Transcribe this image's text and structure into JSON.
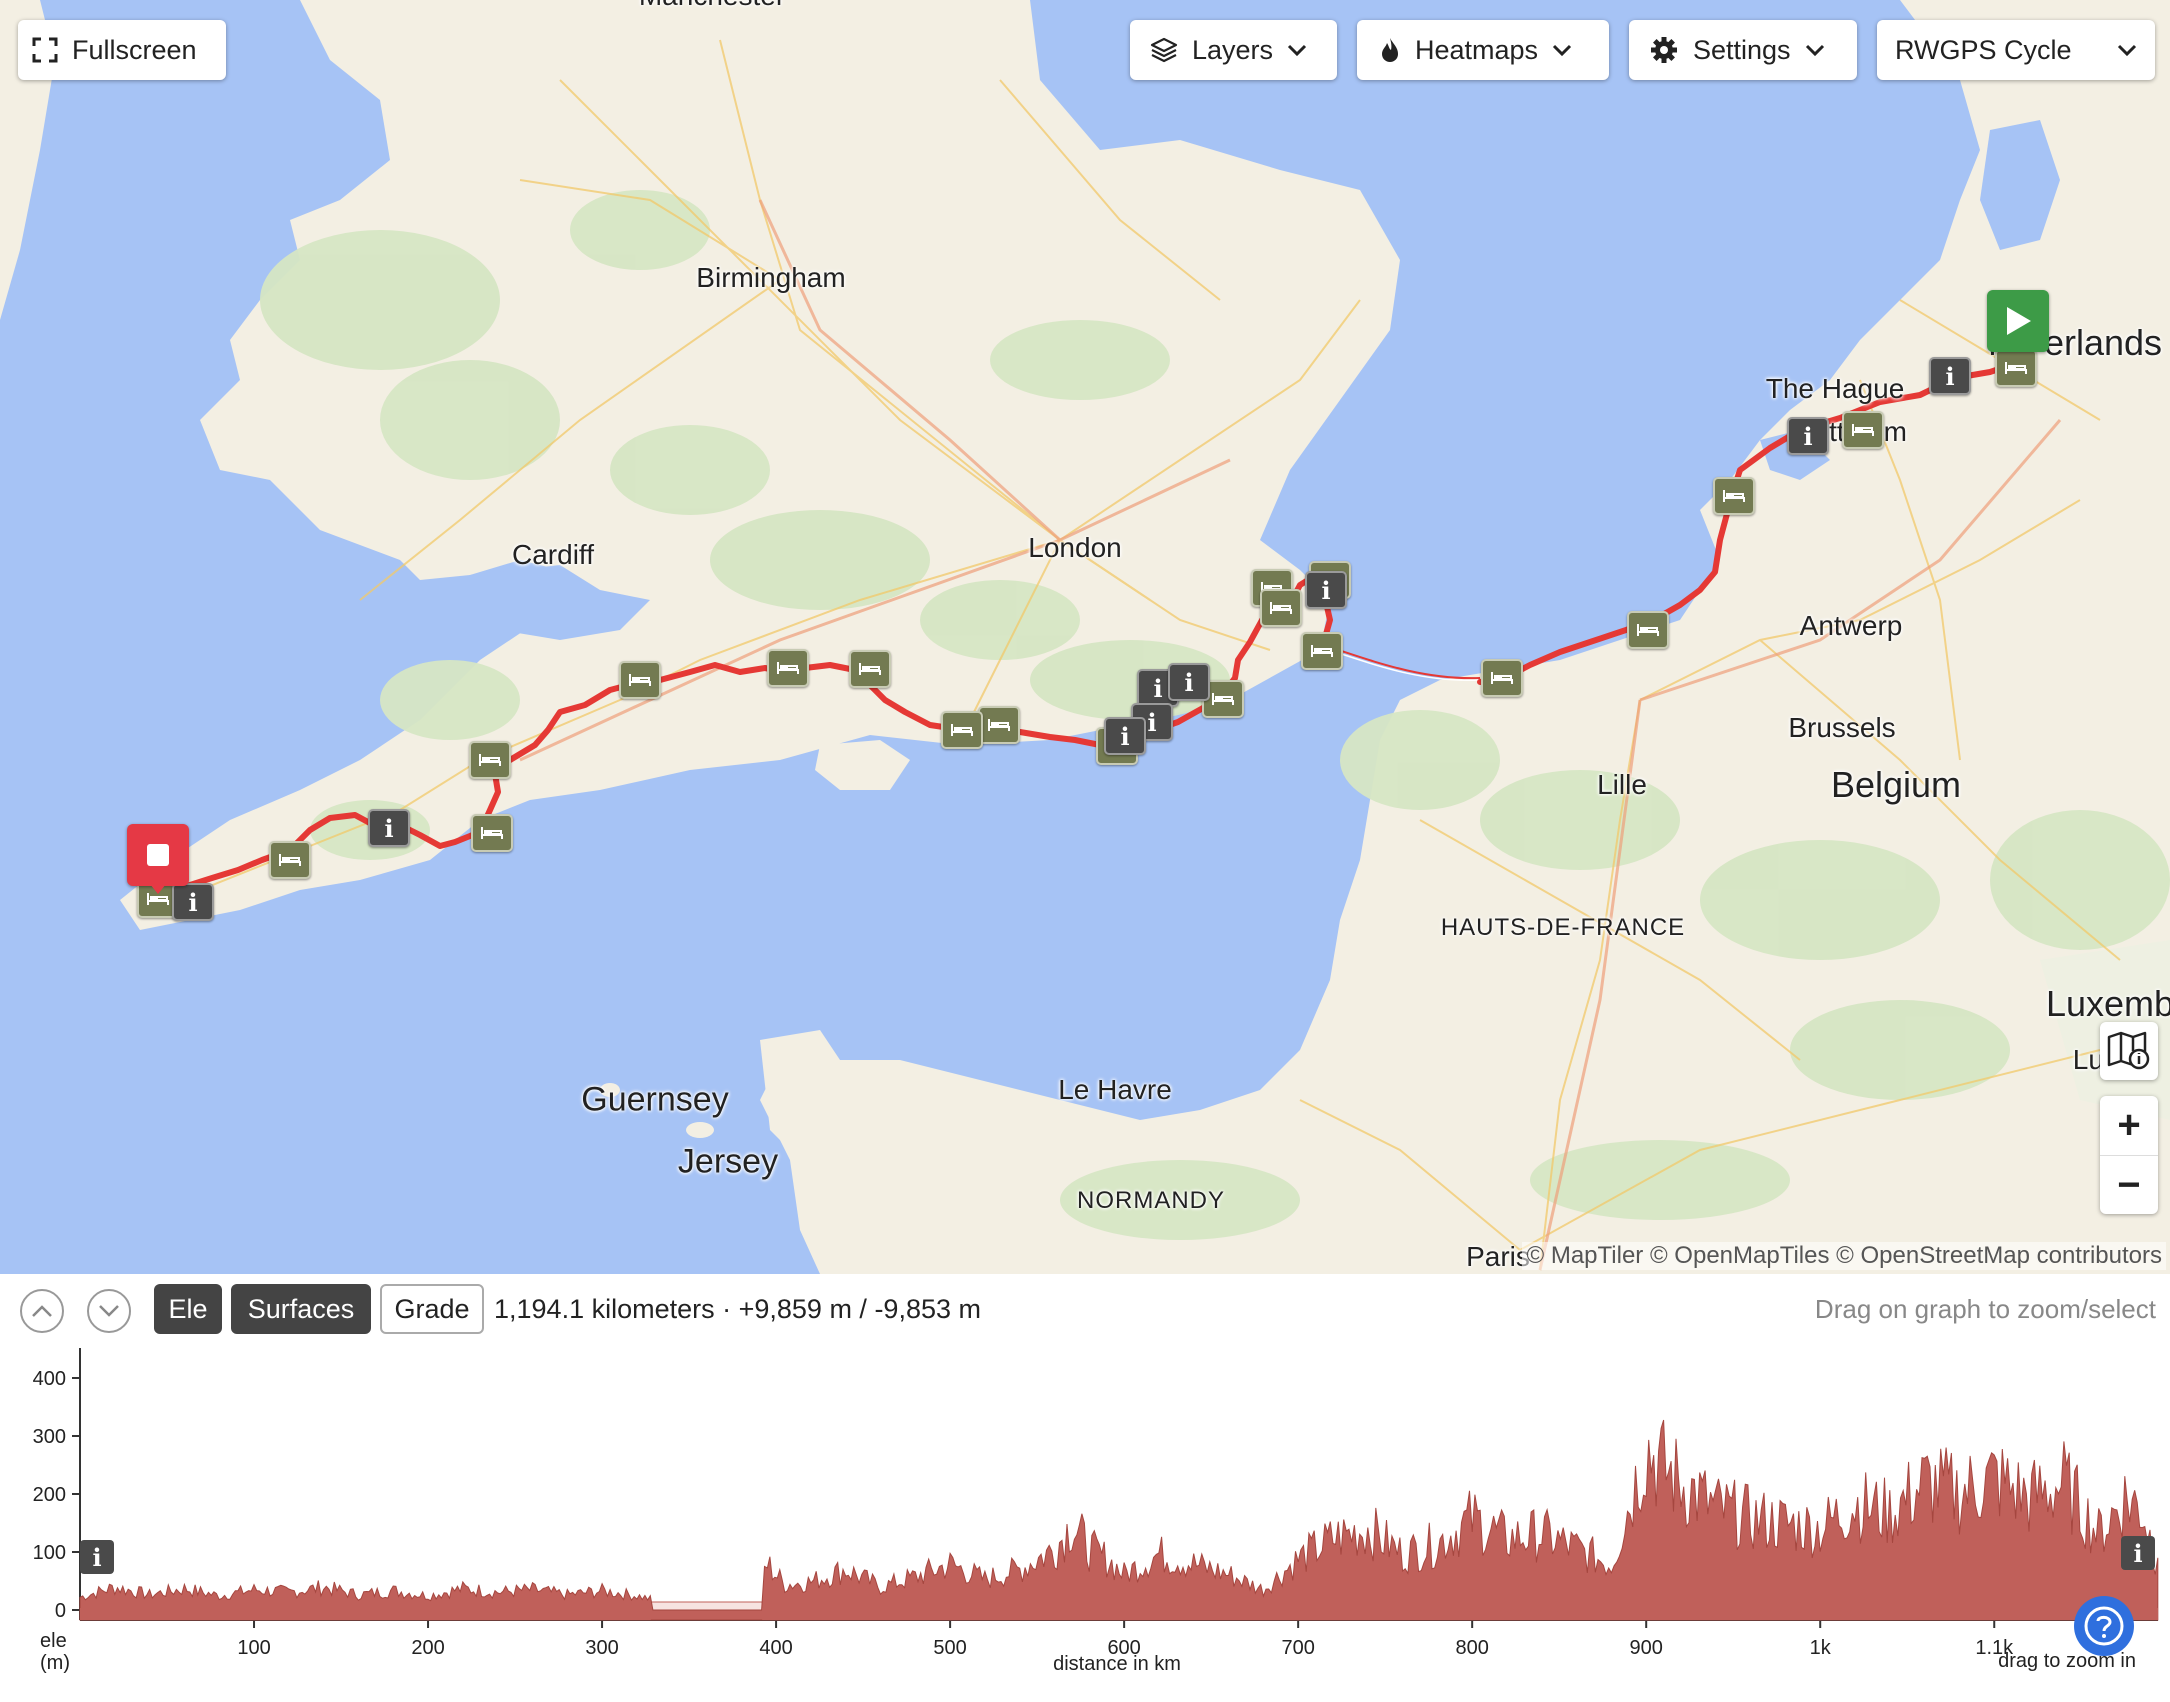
{
  "toolbar": {
    "fullscreen_label": "Fullscreen",
    "layers_label": "Layers",
    "heatmaps_label": "Heatmaps",
    "settings_label": "Settings",
    "map_style_label": "RWGPS Cycle"
  },
  "map": {
    "places": [
      {
        "name": "Birmingham",
        "kind": "city"
      },
      {
        "name": "Cardiff",
        "kind": "city"
      },
      {
        "name": "London",
        "kind": "city"
      },
      {
        "name": "Ne   erlands",
        "kind": "country"
      },
      {
        "name": "The Hague",
        "kind": "city"
      },
      {
        "name": "  tt   dam",
        "kind": "city"
      },
      {
        "name": "Antwerp",
        "kind": "city"
      },
      {
        "name": "Brussels",
        "kind": "city"
      },
      {
        "name": "Lille",
        "kind": "city"
      },
      {
        "name": "Belgium",
        "kind": "country"
      },
      {
        "name": "HAUTS-DE-FRANCE",
        "kind": "region"
      },
      {
        "name": "Luxemb",
        "kind": "country"
      },
      {
        "name": "Lu     o",
        "kind": "city"
      },
      {
        "name": "Guernsey",
        "kind": "island"
      },
      {
        "name": "Jersey",
        "kind": "island"
      },
      {
        "name": "Le Havre",
        "kind": "city"
      },
      {
        "name": "NORMANDY",
        "kind": "region"
      },
      {
        "name": "Paris",
        "kind": "city"
      },
      {
        "name": "Manchester",
        "kind": "city"
      }
    ],
    "attribution": "© MapTiler © OpenMapTiles © OpenStreetMap contributors",
    "zoom_in_label": "+",
    "zoom_out_label": "−",
    "route_color": "#e53935",
    "start_marker_color": "#3d9b47",
    "end_marker_color": "#e53945",
    "lodging_color": "#737a51",
    "info_color": "#4a4a4a",
    "info_glyph": "i"
  },
  "elevation": {
    "tabs": [
      {
        "label": "Ele",
        "active": true
      },
      {
        "label": "Surfaces",
        "active": true
      },
      {
        "label": "Grade",
        "active": false
      }
    ],
    "summary": "1,194.1 kilometers · +9,859 m / -9,853 m",
    "hint": "Drag on graph to zoom/select",
    "bottom_hint": "drag to zoom in",
    "fill_color": "#c0605a",
    "chart_data": {
      "type": "area",
      "title": "",
      "xlabel": "distance in km",
      "ylabel": "ele\n(m)",
      "ylabel_line1": "ele",
      "ylabel_line2": "(m)",
      "xlim": [
        0,
        1194.1
      ],
      "ylim": [
        0,
        400
      ],
      "y_ticks": [
        0,
        100,
        200,
        300,
        400
      ],
      "x_ticks": [
        {
          "value": 100,
          "label": "100"
        },
        {
          "value": 200,
          "label": "200"
        },
        {
          "value": 300,
          "label": "300"
        },
        {
          "value": 400,
          "label": "400"
        },
        {
          "value": 500,
          "label": "500"
        },
        {
          "value": 600,
          "label": "600"
        },
        {
          "value": 700,
          "label": "700"
        },
        {
          "value": 800,
          "label": "800"
        },
        {
          "value": 900,
          "label": "900"
        },
        {
          "value": 1000,
          "label": "1k"
        },
        {
          "value": 1100,
          "label": "1.1k"
        }
      ],
      "series": [
        {
          "x": [
            0,
            20,
            40,
            60,
            80,
            100,
            120,
            140,
            160,
            180,
            200,
            220,
            240,
            260,
            280,
            300,
            320,
            340,
            360,
            380,
            390,
            395,
            405,
            420,
            440,
            460,
            480,
            500,
            520,
            540,
            560,
            570,
            580,
            590,
            600,
            620,
            640,
            660,
            680,
            700,
            720,
            740,
            760,
            780,
            800,
            820,
            840,
            860,
            880,
            900,
            910,
            920,
            940,
            960,
            980,
            1000,
            1020,
            1040,
            1060,
            1080,
            1100,
            1120,
            1140,
            1160,
            1175,
            1185,
            1194
          ],
          "y": [
            25,
            45,
            30,
            42,
            28,
            40,
            35,
            45,
            30,
            38,
            28,
            42,
            35,
            40,
            30,
            38,
            28,
            12,
            8,
            10,
            60,
            90,
            50,
            55,
            80,
            45,
            65,
            90,
            60,
            80,
            120,
            170,
            120,
            100,
            70,
            110,
            90,
            70,
            40,
            100,
            140,
            160,
            110,
            130,
            180,
            140,
            150,
            120,
            90,
            320,
            280,
            250,
            200,
            180,
            170,
            160,
            210,
            190,
            250,
            230,
            260,
            220,
            250,
            150,
            220,
            200,
            90
          ]
        }
      ],
      "gaps": [
        [
          328,
          392
        ]
      ]
    }
  }
}
